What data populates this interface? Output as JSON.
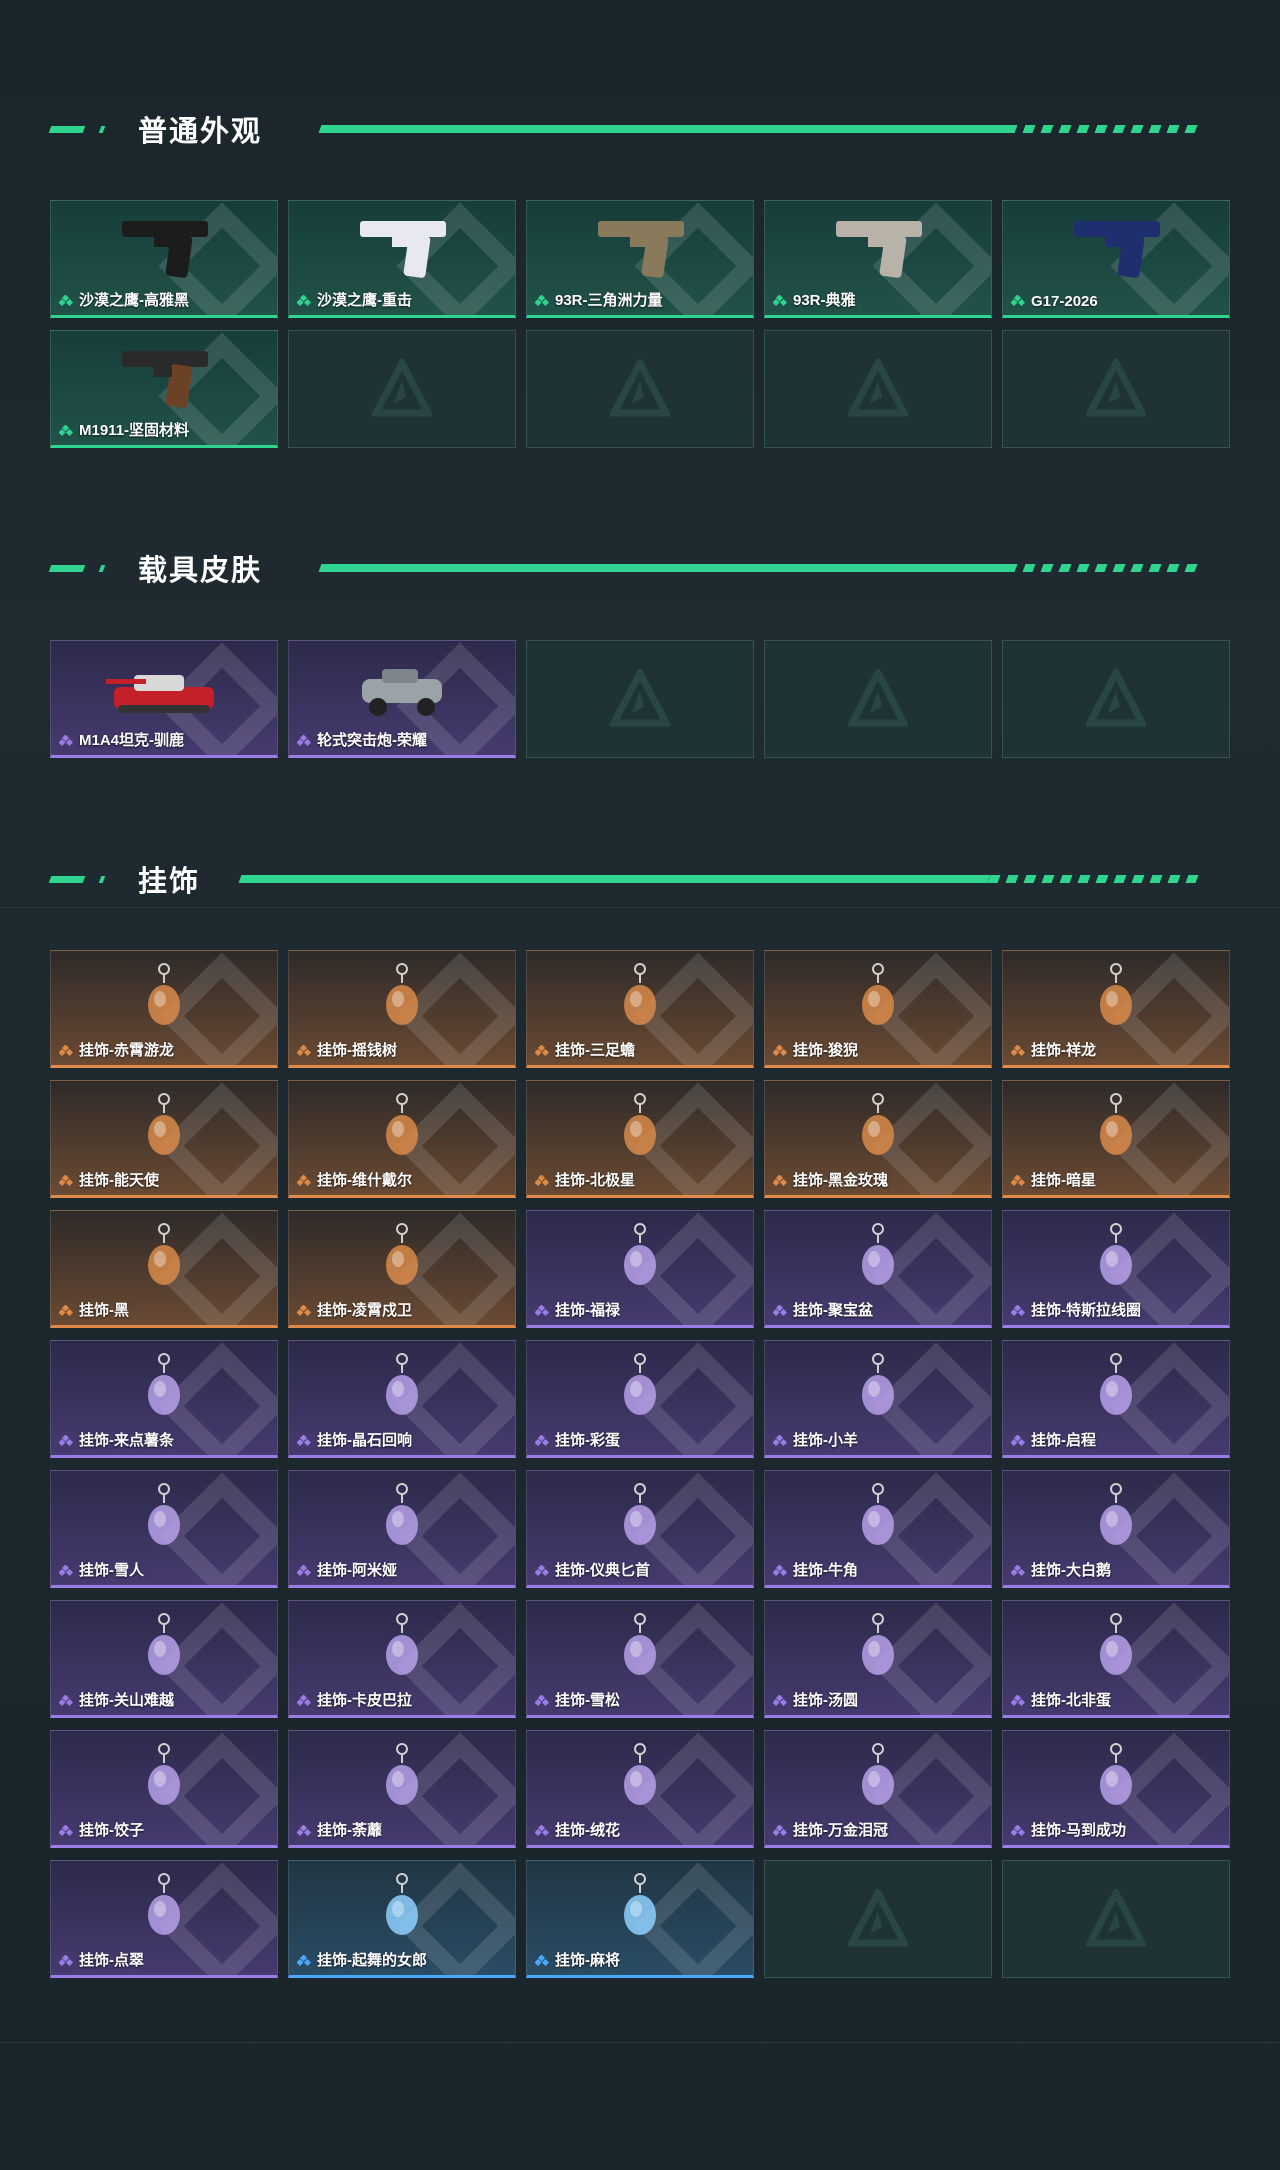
{
  "sections": {
    "weapon_skins": {
      "title": "普通外观",
      "items": [
        {
          "label": "沙漠之鹰-高雅黑",
          "rarity": "green",
          "icon": "pistol-black-icon"
        },
        {
          "label": "沙漠之鹰-重击",
          "rarity": "green",
          "icon": "pistol-white-blue-icon"
        },
        {
          "label": "93R-三角洲力量",
          "rarity": "green",
          "icon": "pistol-tan-icon"
        },
        {
          "label": "93R-典雅",
          "rarity": "green",
          "icon": "pistol-silver-icon"
        },
        {
          "label": "G17-2026",
          "rarity": "green",
          "icon": "pistol-navy-icon"
        },
        {
          "label": "M1911-坚固材料",
          "rarity": "green",
          "icon": "pistol-wood-icon"
        }
      ],
      "empty_slots": 4
    },
    "vehicle_skins": {
      "title": "载具皮肤",
      "items": [
        {
          "label": "M1A4坦克-驯鹿",
          "rarity": "purple",
          "icon": "tank-icon"
        },
        {
          "label": "轮式突击炮-荣耀",
          "rarity": "purple",
          "icon": "armored-car-icon"
        }
      ],
      "empty_slots": 3
    },
    "charms": {
      "title": "挂饰",
      "items": [
        {
          "label": "挂饰-赤霄游龙",
          "rarity": "orange",
          "icon": "dragon-charm-icon"
        },
        {
          "label": "挂饰-摇钱树",
          "rarity": "orange",
          "icon": "money-tree-charm-icon"
        },
        {
          "label": "挂饰-三足蟾",
          "rarity": "orange",
          "icon": "toad-charm-icon"
        },
        {
          "label": "挂饰-狻猊",
          "rarity": "orange",
          "icon": "lion-charm-icon"
        },
        {
          "label": "挂饰-祥龙",
          "rarity": "orange",
          "icon": "dragon-charm-icon"
        },
        {
          "label": "挂饰-能天使",
          "rarity": "orange",
          "icon": "tag-charm-icon"
        },
        {
          "label": "挂饰-维什戴尔",
          "rarity": "orange",
          "icon": "tag-charm-icon"
        },
        {
          "label": "挂饰-北极星",
          "rarity": "orange",
          "icon": "star-charm-icon"
        },
        {
          "label": "挂饰-黑金玫瑰",
          "rarity": "orange",
          "icon": "rose-charm-icon"
        },
        {
          "label": "挂饰-暗星",
          "rarity": "orange",
          "icon": "bird-charm-icon"
        },
        {
          "label": "挂饰-黑",
          "rarity": "orange",
          "icon": "tag-charm-icon"
        },
        {
          "label": "挂饰-凌霄戍卫",
          "rarity": "orange",
          "icon": "guard-charm-icon"
        },
        {
          "label": "挂饰-福禄",
          "rarity": "purple",
          "icon": "gourd-charm-icon"
        },
        {
          "label": "挂饰-聚宝盆",
          "rarity": "purple",
          "icon": "treasure-bowl-charm-icon"
        },
        {
          "label": "挂饰-特斯拉线圈",
          "rarity": "purple",
          "icon": "coil-charm-icon"
        },
        {
          "label": "挂饰-来点薯条",
          "rarity": "purple",
          "icon": "fries-charm-icon"
        },
        {
          "label": "挂饰-晶石回响",
          "rarity": "purple",
          "icon": "crystal-charm-icon"
        },
        {
          "label": "挂饰-彩蛋",
          "rarity": "purple",
          "icon": "egg-charm-icon"
        },
        {
          "label": "挂饰-小羊",
          "rarity": "purple",
          "icon": "lamb-charm-icon"
        },
        {
          "label": "挂饰-启程",
          "rarity": "purple",
          "icon": "ring-charm-icon"
        },
        {
          "label": "挂饰-雪人",
          "rarity": "purple",
          "icon": "snowman-charm-icon"
        },
        {
          "label": "挂饰-阿米娅",
          "rarity": "purple",
          "icon": "rabbit-charm-icon"
        },
        {
          "label": "挂饰-仪典匕首",
          "rarity": "purple",
          "icon": "dagger-charm-icon"
        },
        {
          "label": "挂饰-牛角",
          "rarity": "purple",
          "icon": "horn-charm-icon"
        },
        {
          "label": "挂饰-大白鹅",
          "rarity": "purple",
          "icon": "goose-charm-icon"
        },
        {
          "label": "挂饰-关山难越",
          "rarity": "purple",
          "icon": "scroll-charm-icon"
        },
        {
          "label": "挂饰-卡皮巴拉",
          "rarity": "purple",
          "icon": "capybara-charm-icon"
        },
        {
          "label": "挂饰-雪松",
          "rarity": "purple",
          "icon": "pine-charm-icon"
        },
        {
          "label": "挂饰-汤圆",
          "rarity": "purple",
          "icon": "bowl-charm-icon"
        },
        {
          "label": "挂饰-北非蛋",
          "rarity": "purple",
          "icon": "pan-charm-icon"
        },
        {
          "label": "挂饰-饺子",
          "rarity": "purple",
          "icon": "dumpling-charm-icon"
        },
        {
          "label": "挂饰-荼蘼",
          "rarity": "purple",
          "icon": "flower-charm-icon"
        },
        {
          "label": "挂饰-绒花",
          "rarity": "purple",
          "icon": "velvet-flower-charm-icon"
        },
        {
          "label": "挂饰-万金泪冠",
          "rarity": "purple",
          "icon": "crown-charm-icon"
        },
        {
          "label": "挂饰-马到成功",
          "rarity": "purple",
          "icon": "horse-charm-icon"
        },
        {
          "label": "挂饰-点翠",
          "rarity": "purple",
          "icon": "kingfisher-charm-icon"
        },
        {
          "label": "挂饰-起舞的女郎",
          "rarity": "blue",
          "icon": "dancer-charm-icon"
        },
        {
          "label": "挂饰-麻将",
          "rarity": "blue",
          "icon": "mahjong-charm-icon"
        }
      ],
      "empty_slots": 2
    }
  },
  "colors": {
    "accent": "#2fd58f",
    "green": "#2fd58f",
    "purple": "#9a7de6",
    "orange": "#e08a4a",
    "blue": "#4aa8ff"
  }
}
